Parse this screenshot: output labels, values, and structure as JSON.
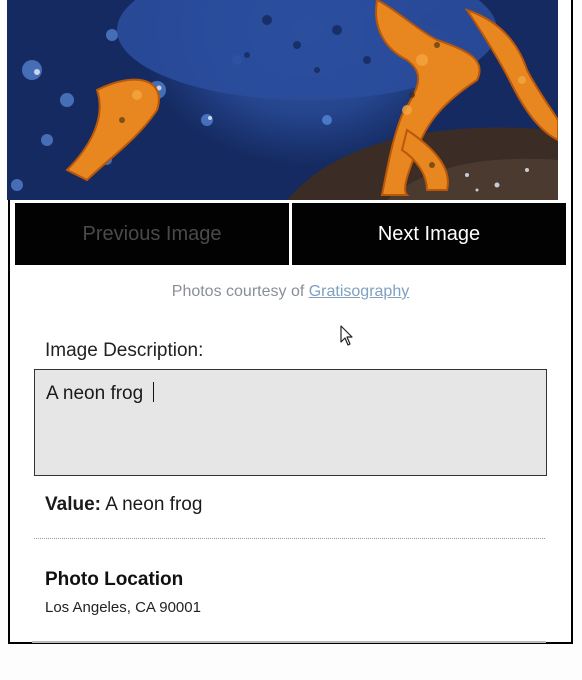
{
  "gallery": {
    "photo_alt": "neon frog",
    "prev_label": "Previous Image",
    "next_label": "Next Image",
    "credit_prefix": "Photos courtesy of ",
    "credit_link": "Gratisography"
  },
  "form": {
    "description_label": "Image Description:",
    "description_value": "A neon frog ",
    "value_label": "Value:",
    "value_text": " A neon frog"
  },
  "location": {
    "title": "Photo Location",
    "value": "Los Angeles, CA 90001"
  },
  "colors": {
    "button_bg": "#020202",
    "button_disabled_text": "#4a4a4a",
    "button_text": "#ffffff",
    "textarea_bg": "#e6e6e6",
    "link": "#7fa0c0"
  },
  "icons": {
    "cursor": "mouse-pointer-icon"
  }
}
